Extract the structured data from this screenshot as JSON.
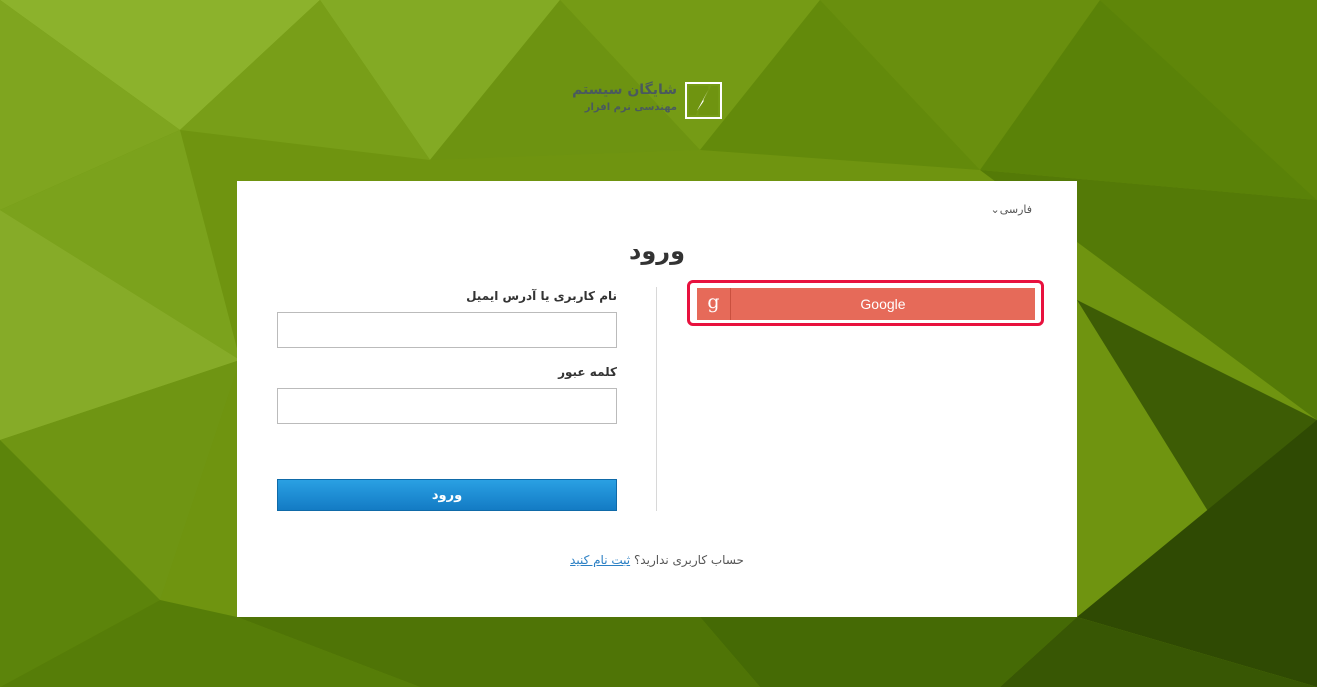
{
  "brand": {
    "name": "شایگان سیستم",
    "tagline": "مهندسی نرم افزار"
  },
  "colors": {
    "background": "#6f9410",
    "google": "#e66a59",
    "highlight": "#e8113e",
    "primary": "#1a8ad4"
  },
  "language": {
    "label": "فارسی",
    "icon": "chevron-down-icon"
  },
  "login": {
    "title": "ورود",
    "google_label": "Google",
    "google_icon": "google-g-icon",
    "username_label": "نام کاربری یا آدرس ایمیل",
    "username_value": "",
    "password_label": "کلمه عبور",
    "password_value": "",
    "submit_label": "ورود"
  },
  "footer": {
    "question": "حساب کاربری ندارید؟",
    "register_link": "ثبت نام کنید"
  }
}
